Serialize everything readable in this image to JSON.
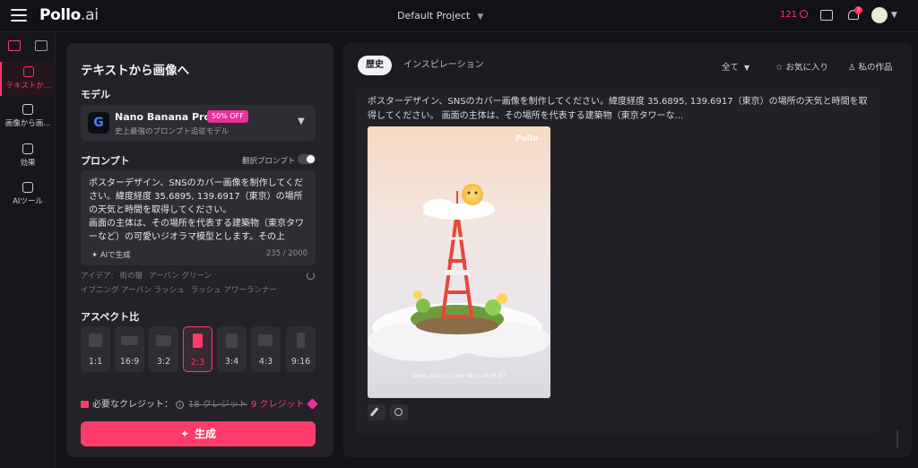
{
  "app": {
    "logo": "Pollo",
    "logo_suffix": ".ai",
    "project": "Default Project",
    "credits": "121",
    "notifications": "3"
  },
  "nav": {
    "items": [
      {
        "label": "テキストか..."
      },
      {
        "label": "画像から画..."
      },
      {
        "label": "効果"
      },
      {
        "label": "AIツール"
      }
    ]
  },
  "panel": {
    "title": "テキストから画像へ",
    "model_label": "モデル",
    "model": {
      "name": "Nano Banana Pro",
      "badge": "50% OFF",
      "desc": "史上最強のプロンプト追従モデル"
    },
    "prompt_label": "プロンプト",
    "translate_label": "翻訳プロンプト",
    "prompt_text": "ポスターデザイン、SNSのカバー画像を制作してください。緯度経度 35.6895, 139.6917（東京）の場所の天気と時間を取得してください。\n画面の主体は、その場所を代表する建築物（東京タワーなど）の可愛いジオラマ模型とします。その上",
    "ai_generate": "AIで生成",
    "char_count": "235 / 2000",
    "ideas_label": "アイデア:",
    "ideas": [
      "街の猫",
      "アーバン グリーン",
      "イブニング アーバン ラッシュ",
      "ラッシュ アワーランナー"
    ],
    "aspect_label": "アスペクト比",
    "ratios": [
      "1:1",
      "16:9",
      "3:2",
      "2:3",
      "3:4",
      "4:3",
      "9:16"
    ],
    "selected_ratio": "2:3",
    "credits_label": "必要なクレジット：",
    "old_credits": "18 クレジット",
    "new_credits": "9 クレジット",
    "generate_button": "生成"
  },
  "results": {
    "tabs": [
      "歴史",
      "インスピレーション"
    ],
    "filter": "全て",
    "favorites": "お気に入り",
    "my_works": "私の作品",
    "prompt_preview": "ポスターデザイン、SNSのカバー画像を制作してください。緯度経度 35.6895, 139.6917（東京）の場所の天気と時間を取得してください。 画面の主体は、その場所を代表する建築物（東京タワーな...",
    "image_logo": "Pollo",
    "image_caption": "Tokyo, Japan | Clear Sky | 19:35 JST"
  },
  "colors": {
    "accent": "#ff3b6b",
    "badge": "#e9309a",
    "panel": "#232228",
    "background": "#131218"
  }
}
